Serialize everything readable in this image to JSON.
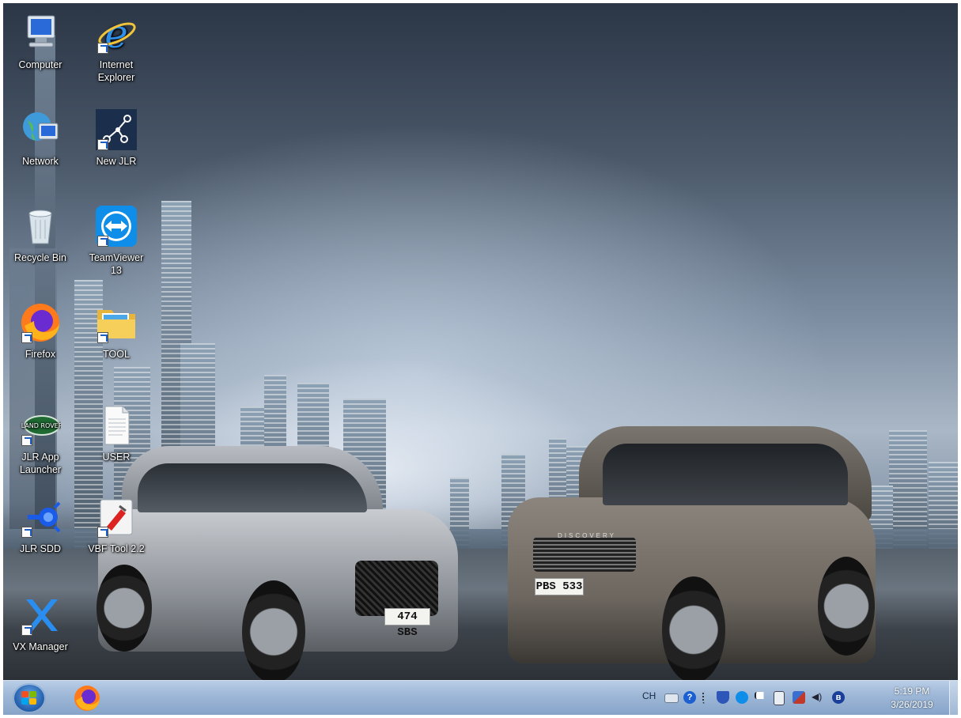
{
  "desktop": {
    "icons": [
      {
        "label": "Computer",
        "icon": "computer-icon",
        "shortcut": false
      },
      {
        "label": "Internet Explorer",
        "icon": "internet-explorer-icon",
        "shortcut": true
      },
      {
        "label": "Network",
        "icon": "network-icon",
        "shortcut": false
      },
      {
        "label": "New JLR",
        "icon": "new-jlr-icon",
        "shortcut": true
      },
      {
        "label": "Recycle Bin",
        "icon": "recycle-bin-icon",
        "shortcut": false
      },
      {
        "label": "TeamViewer 13",
        "icon": "teamviewer-icon",
        "shortcut": true
      },
      {
        "label": "Firefox",
        "icon": "firefox-icon",
        "shortcut": true
      },
      {
        "label": "TOOL",
        "icon": "folder-icon",
        "shortcut": true
      },
      {
        "label": "JLR App Launcher",
        "icon": "jlr-app-launcher-icon",
        "shortcut": true
      },
      {
        "label": "USER",
        "icon": "text-file-icon",
        "shortcut": false
      },
      {
        "label": "JLR SDD",
        "icon": "jlr-sdd-icon",
        "shortcut": true
      },
      {
        "label": "VBF Tool 2.2",
        "icon": "vbf-tool-icon",
        "shortcut": true
      },
      {
        "label": "VX Manager",
        "icon": "vx-manager-icon",
        "shortcut": true
      }
    ],
    "wallpaper": {
      "plate_left": "474 SBS",
      "plate_right": "PBS 533",
      "badge_right": "DISCOVERY"
    }
  },
  "taskbar": {
    "pinned": [
      {
        "icon": "firefox-icon"
      }
    ],
    "tray": {
      "language": "CH",
      "icons": [
        "keyboard-icon",
        "help-icon",
        "tray-expand-icon",
        "antivirus-icon",
        "teamviewer-tray-icon",
        "action-center-flag-icon",
        "device-icon",
        "network-tray-icon",
        "volume-icon",
        "bluetooth-icon"
      ]
    },
    "clock": {
      "time": "5:19 PM",
      "date": "3/26/2019"
    }
  },
  "colors": {
    "taskbar": "#9cb6d6",
    "accent": "#1d5fc4"
  }
}
